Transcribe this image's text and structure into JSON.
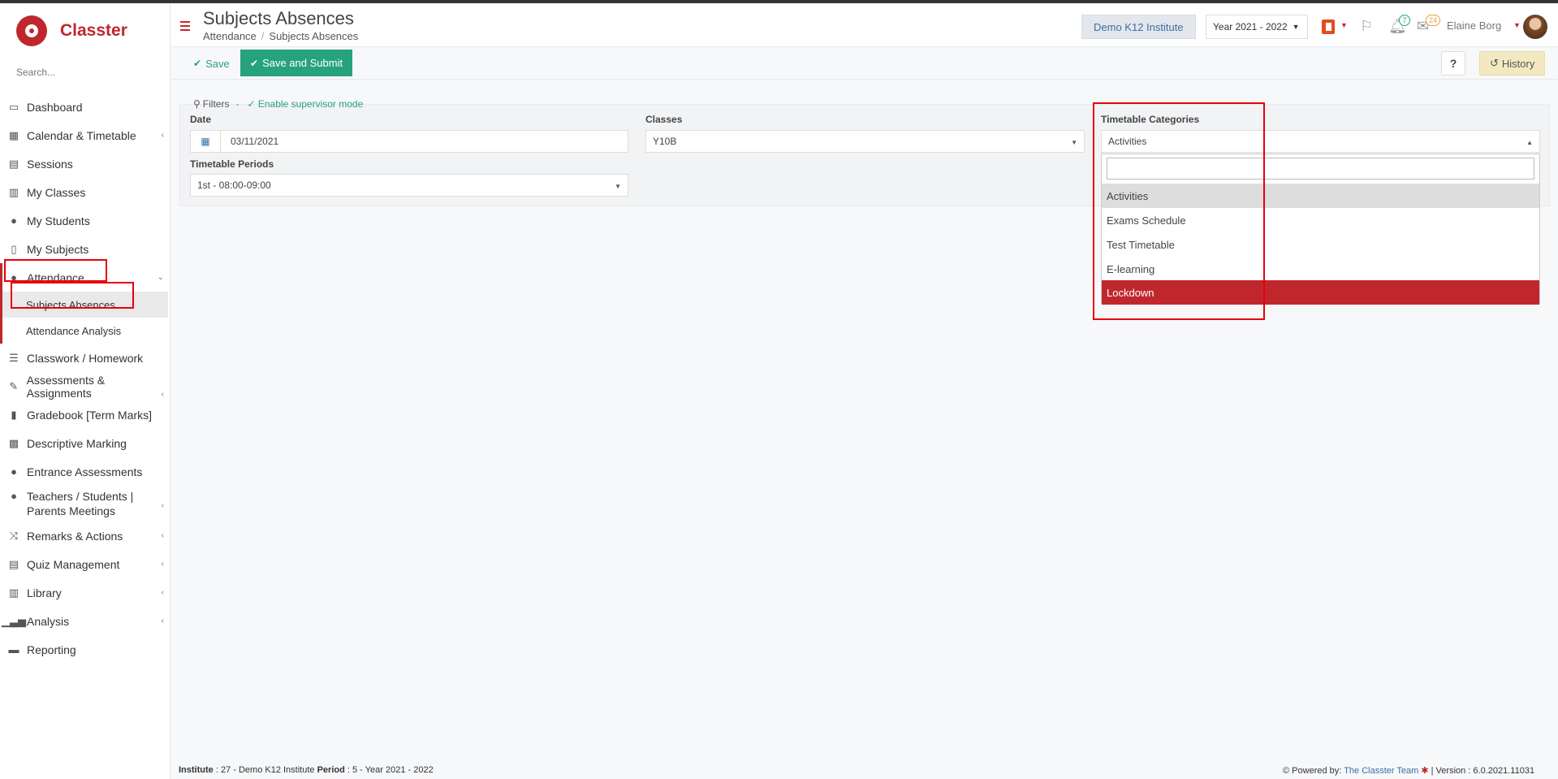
{
  "app": {
    "name": "Classter"
  },
  "sidebar": {
    "search_placeholder": "Search...",
    "items": [
      {
        "label": "Dashboard",
        "icon": "laptop-icon"
      },
      {
        "label": "Calendar & Timetable",
        "icon": "calendar-icon"
      },
      {
        "label": "Sessions",
        "icon": "sessions-icon"
      },
      {
        "label": "My Classes",
        "icon": "classes-icon"
      },
      {
        "label": "My Students",
        "icon": "students-icon"
      },
      {
        "label": "My Subjects",
        "icon": "book-icon"
      },
      {
        "label": "Attendance",
        "icon": "attendance-icon"
      },
      {
        "label": "Classwork / Homework",
        "icon": "checklist-icon"
      },
      {
        "label": "Assessments & Assignments",
        "icon": "edit-icon"
      },
      {
        "label": "Gradebook [Term Marks]",
        "icon": "gradebook-icon"
      },
      {
        "label": "Descriptive Marking",
        "icon": "marking-icon"
      },
      {
        "label": "Entrance Assessments",
        "icon": "entrance-icon"
      },
      {
        "label": "Teachers / Students | Parents Meetings",
        "icon": "meetings-icon"
      },
      {
        "label": "Remarks & Actions",
        "icon": "shuffle-icon"
      },
      {
        "label": "Quiz Management",
        "icon": "quiz-icon"
      },
      {
        "label": "Library",
        "icon": "library-icon"
      },
      {
        "label": "Analysis",
        "icon": "chart-icon"
      },
      {
        "label": "Reporting",
        "icon": "printer-icon"
      }
    ],
    "attendance_sub": [
      "Subjects Absences",
      "Attendance Analysis"
    ]
  },
  "header": {
    "title": "Subjects Absences",
    "breadcrumb": [
      "Attendance",
      "Subjects Absences"
    ],
    "institute": "Demo K12 Institute",
    "year": "Year 2021 - 2022",
    "notifications_count": "7",
    "messages_count": "24",
    "user_name": "Elaine Borg"
  },
  "toolbar": {
    "save_label": "Save",
    "submit_label": "Save and Submit",
    "help_label": "?",
    "history_label": "History"
  },
  "filters": {
    "title": "Filters",
    "separator": "-",
    "supervisor_mode": "Enable supervisor mode",
    "date_label": "Date",
    "date_value": "03/11/2021",
    "classes_label": "Classes",
    "classes_value": "Y10B",
    "categories_label": "Timetable Categories",
    "categories_value": "Activities",
    "periods_label": "Timetable Periods",
    "periods_value": "1st - 08:00-09:00"
  },
  "dropdown": {
    "options": [
      "Activities",
      "Exams Schedule",
      "Test Timetable",
      "E-learning",
      "Lockdown"
    ],
    "selected": "Activities",
    "highlighted": "Lockdown"
  },
  "footer": {
    "institute_label": "Institute",
    "institute_value": ": 27 - Demo K12 Institute",
    "period_label": "Period",
    "period_value": ": 5 - Year 2021 - 2022",
    "powered_by": "Powered by:",
    "team": "The Classter Team",
    "version": "| Version : 6.0.2021.11031"
  },
  "colors": {
    "brand": "#c0272d",
    "accent": "#26a37c",
    "annotation": "#e8000b"
  }
}
